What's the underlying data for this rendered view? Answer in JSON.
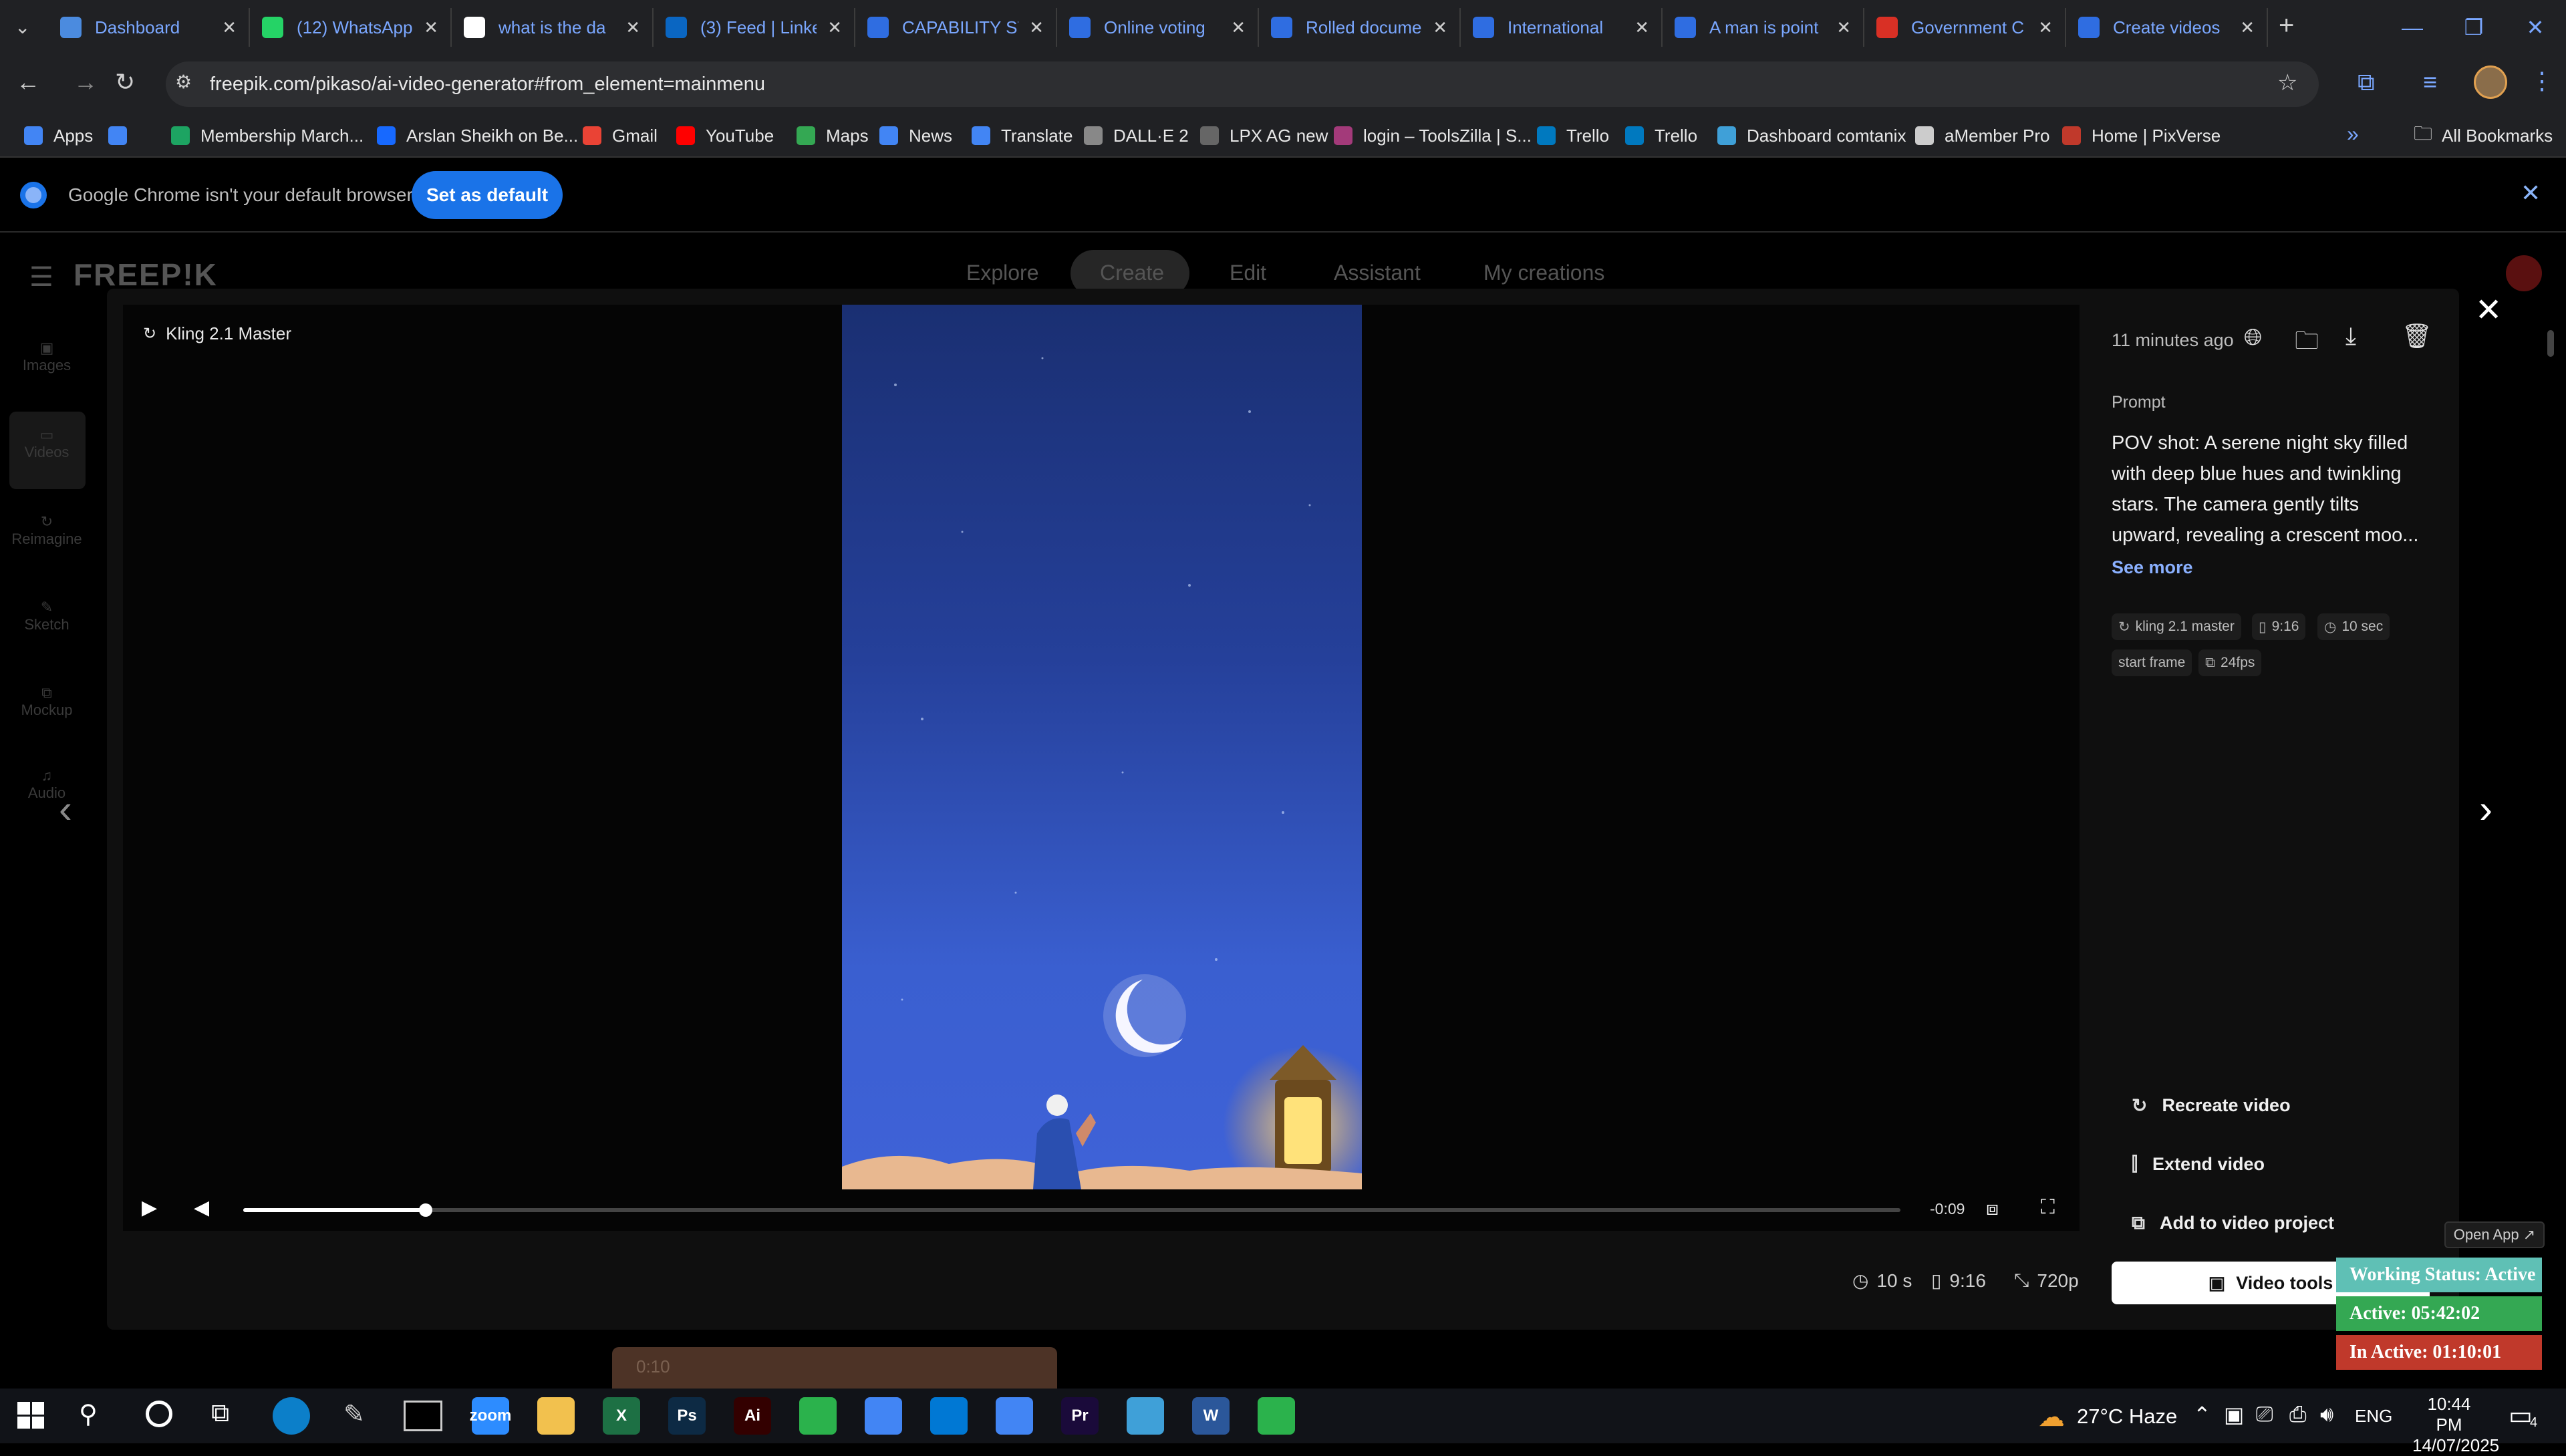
{
  "browser": {
    "tabs": [
      {
        "title": "Dashboard",
        "icon": "dashboard-icon",
        "color": "#4b8bdf"
      },
      {
        "title": "(12) WhatsApp",
        "icon": "whatsapp-icon",
        "color": "#25d366"
      },
      {
        "title": "what is the da",
        "icon": "google-icon",
        "color": "#ffffff"
      },
      {
        "title": "(3) Feed | Linke",
        "icon": "linkedin-icon",
        "color": "#0a66c2"
      },
      {
        "title": "CAPABILITY ST",
        "icon": "document-icon",
        "color": "#2f6de1"
      },
      {
        "title": "Online voting",
        "icon": "document-icon",
        "color": "#2f6de1"
      },
      {
        "title": "Rolled docume",
        "icon": "document-icon",
        "color": "#2f6de1"
      },
      {
        "title": "International",
        "icon": "document-icon",
        "color": "#2f6de1"
      },
      {
        "title": "A man is point",
        "icon": "document-icon",
        "color": "#2f6de1"
      },
      {
        "title": "Government C",
        "icon": "gem-icon",
        "color": "#d93025"
      },
      {
        "title": "Create videos",
        "icon": "document-icon",
        "color": "#2f6de1"
      }
    ],
    "url": "freepik.com/pikaso/ai-video-generator#from_element=mainmenu",
    "bookmarks": [
      {
        "label": "Apps",
        "color": "#4285f4"
      },
      {
        "label": "",
        "color": "#4285f4"
      },
      {
        "label": "Membership March...",
        "color": "#1da462"
      },
      {
        "label": "Arslan Sheikh on Be...",
        "color": "#1769ff"
      },
      {
        "label": "Gmail",
        "color": "#ea4335"
      },
      {
        "label": "YouTube",
        "color": "#ff0000"
      },
      {
        "label": "Maps",
        "color": "#34a853"
      },
      {
        "label": "News",
        "color": "#4285f4"
      },
      {
        "label": "Translate",
        "color": "#4285f4"
      },
      {
        "label": "DALL·E 2",
        "color": "#888888"
      },
      {
        "label": "LPX AG new",
        "color": "#666666"
      },
      {
        "label": "login – ToolsZilla | S...",
        "color": "#a33a7a"
      },
      {
        "label": "Trello",
        "color": "#0079bf"
      },
      {
        "label": "Trello",
        "color": "#0079bf"
      },
      {
        "label": "Dashboard comtanix",
        "color": "#3fa0d8"
      },
      {
        "label": "aMember Pro",
        "color": "#cccccc"
      },
      {
        "label": "Home | PixVerse",
        "color": "#c0392b"
      }
    ],
    "all_bookmarks": "All Bookmarks",
    "infobar": {
      "message": "Google Chrome isn't your default browser",
      "button": "Set as default"
    }
  },
  "freepik": {
    "logo": "FREEP!K",
    "nav": [
      "Explore",
      "Create",
      "Edit",
      "Assistant",
      "My creations"
    ],
    "sidebar": [
      "Images",
      "Videos",
      "Reimagine",
      "Sketch",
      "Mockup",
      "Audio"
    ]
  },
  "modal": {
    "model_label": "Kling 2.1 Master",
    "time_ago": "11 minutes ago",
    "prompt_heading": "Prompt",
    "prompt_lines": [
      "POV shot: A serene night sky filled",
      "with deep blue hues and twinkling",
      "stars. The camera gently tilts",
      "upward, revealing a crescent moo..."
    ],
    "see_more": "See more",
    "chips": [
      "kling 2.1 master",
      "9:16",
      "10 sec",
      "start frame",
      "24fps"
    ],
    "actions": [
      "Recreate video",
      "Extend video",
      "Add to video project"
    ],
    "video_tools": "Video tools",
    "player": {
      "time_remaining": "-0:09",
      "progress": 0.11
    },
    "meta": {
      "duration": "10 s",
      "ratio": "9:16",
      "resolution": "720p"
    },
    "below_thumb_time": "0:10"
  },
  "widget": {
    "open_app": "Open App ↗",
    "working": "Working Status: Active",
    "active": "Active: 05:42:02",
    "inactive": "In Active: 01:10:01"
  },
  "taskbar": {
    "apps": [
      {
        "name": "zoom",
        "label": "zoom",
        "color": "#2d8cff"
      },
      {
        "name": "file-explorer",
        "label": "",
        "color": "#f2c14e"
      },
      {
        "name": "excel",
        "label": "X",
        "color": "#1d7044"
      },
      {
        "name": "photoshop",
        "label": "Ps",
        "color": "#0d2a44"
      },
      {
        "name": "illustrator",
        "label": "Ai",
        "color": "#330000"
      },
      {
        "name": "app-green",
        "label": "",
        "color": "#2bb24c"
      },
      {
        "name": "chrome",
        "label": "",
        "color": "#4285f4"
      },
      {
        "name": "vscode",
        "label": "",
        "color": "#0078d4"
      },
      {
        "name": "chrome-profile",
        "label": "",
        "color": "#4285f4"
      },
      {
        "name": "premiere",
        "label": "Pr",
        "color": "#1a0a3a"
      },
      {
        "name": "app-blue",
        "label": "",
        "color": "#3fa0d8"
      },
      {
        "name": "word",
        "label": "W",
        "color": "#2b579a"
      },
      {
        "name": "app-green-2",
        "label": "",
        "color": "#2bb24c"
      }
    ],
    "weather": "27°C Haze",
    "language": "ENG",
    "time": "10:44 PM",
    "date": "14/07/2025",
    "notification_count": "4"
  },
  "colors": {
    "accent": "#1a73e8",
    "widget_active": "#34a853",
    "widget_inactive": "#c0392b",
    "widget_working": "#5fc0b5"
  }
}
